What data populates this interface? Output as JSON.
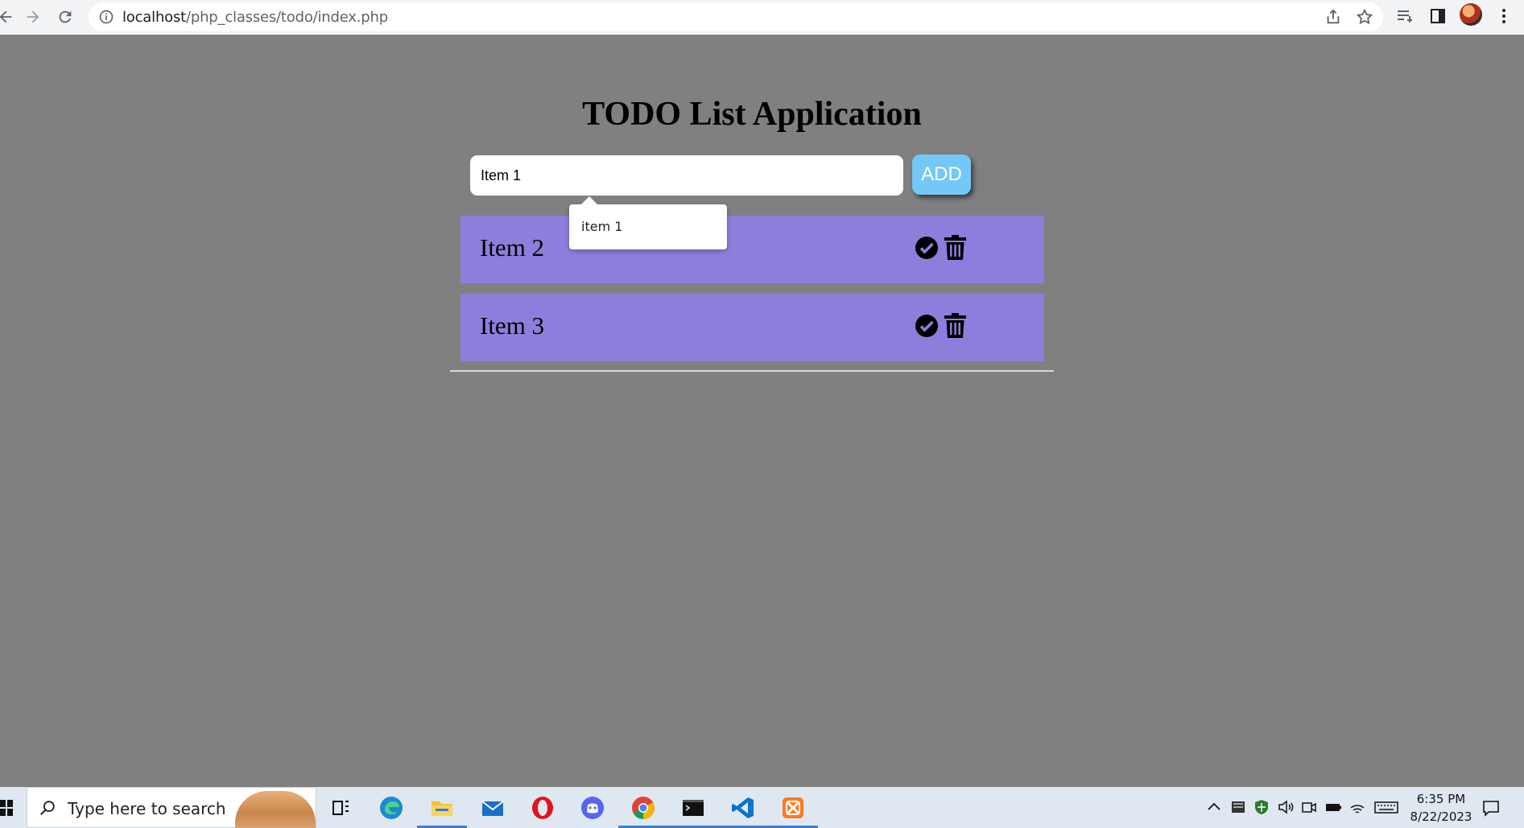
{
  "browser": {
    "url_host": "localhost",
    "url_path": "/php_classes/todo/index.php"
  },
  "page": {
    "title": "TODO List Application",
    "input_value": "Item 1",
    "add_label": "ADD",
    "autocomplete_option": "item 1",
    "items": [
      {
        "label": "Item 2"
      },
      {
        "label": "Item 3"
      }
    ],
    "colors": {
      "background": "#808080",
      "item_background": "#8b7fdb",
      "add_button": "#74c8f5"
    }
  },
  "taskbar": {
    "search_placeholder": "Type here to search",
    "time": "6:35 PM",
    "date": "8/22/2023",
    "apps": [
      "task-view-icon",
      "edge-icon",
      "file-explorer-icon",
      "mail-icon",
      "opera-icon",
      "discord-icon",
      "chrome-icon",
      "terminal-icon",
      "vscode-icon",
      "xampp-icon"
    ]
  }
}
